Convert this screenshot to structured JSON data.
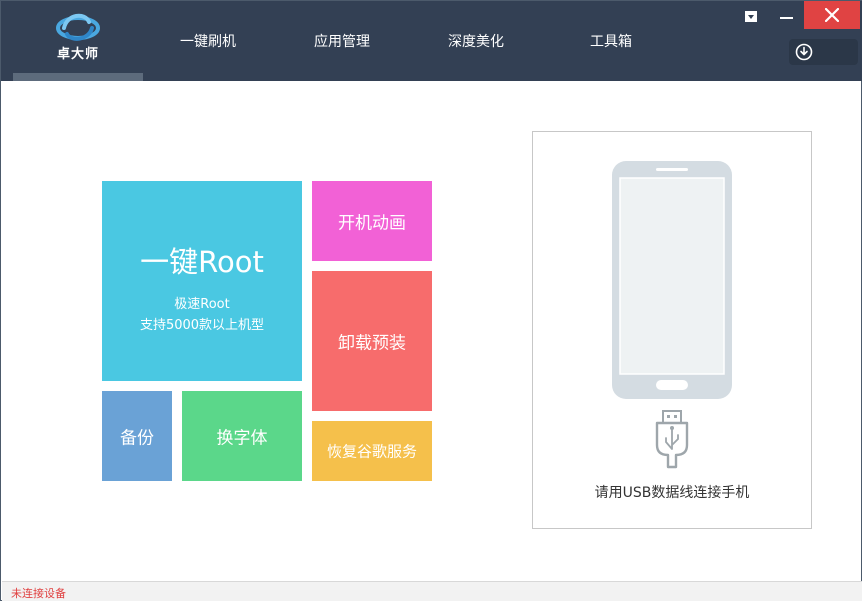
{
  "app": {
    "logo_text": "卓大师",
    "colors": {
      "header": "#334054",
      "close_button": "#e04343",
      "status_text": "#e04040"
    }
  },
  "nav": {
    "items": [
      {
        "label": "一键刷机"
      },
      {
        "label": "应用管理"
      },
      {
        "label": "深度美化"
      },
      {
        "label": "工具箱"
      }
    ],
    "selected": "logo"
  },
  "window_controls": {
    "icons": [
      "menu-dropdown-icon",
      "minimize-icon",
      "close-icon"
    ]
  },
  "download": {
    "icon": "download-icon"
  },
  "tiles": {
    "root": {
      "title": "一键Root",
      "line1": "极速Root",
      "line2": "支持5000款以上机型",
      "color": "#4ac8e2"
    },
    "boot_animation": {
      "label": "开机动画",
      "color": "#f261d6"
    },
    "uninstall_preinstalled": {
      "label": "卸载预装",
      "color": "#f76c6c"
    },
    "backup": {
      "label": "备份",
      "color": "#6aa2d6"
    },
    "change_font": {
      "label": "换字体",
      "color": "#5bd78a"
    },
    "restore_google": {
      "label": "恢复谷歌服务",
      "color": "#f5c04b"
    }
  },
  "device_panel": {
    "phone_icon": "smartphone-icon",
    "usb_icon": "usb-cable-icon",
    "message": "请用USB数据线连接手机"
  },
  "status_bar": {
    "text": "未连接设备"
  }
}
